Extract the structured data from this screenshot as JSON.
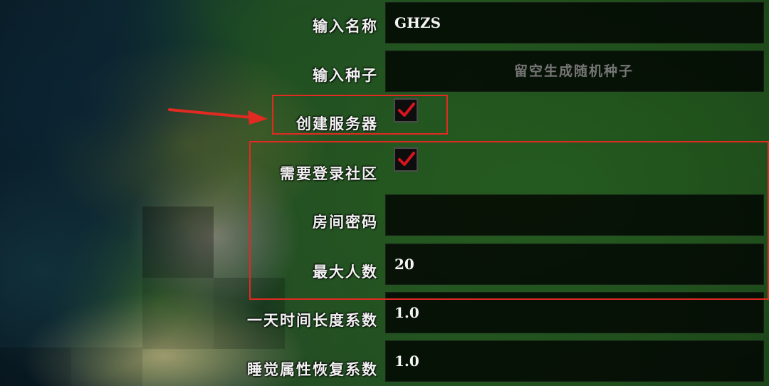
{
  "form": {
    "name_label": "输入名称",
    "name_value": "GHZS",
    "seed_label": "输入种子",
    "seed_placeholder": "留空生成随机种子",
    "seed_value": "",
    "create_server_label": "创建服务器",
    "create_server_checked": true,
    "require_login_label": "需要登录社区",
    "require_login_checked": true,
    "room_password_label": "房间密码",
    "room_password_value": "",
    "max_players_label": "最大人数",
    "max_players_value": "20",
    "day_length_label": "一天时间长度系数",
    "day_length_value": "1.0",
    "sleep_recovery_label": "睡觉属性恢复系数",
    "sleep_recovery_value": "1.0"
  },
  "colors": {
    "annotation": "#e02a22",
    "checkmark": "#d8141e",
    "field_bg": "#000000",
    "label_text": "#f2f2f2"
  },
  "icons": {
    "checkmark": "checkmark-icon",
    "annotation_arrow": "arrow-right-icon"
  }
}
